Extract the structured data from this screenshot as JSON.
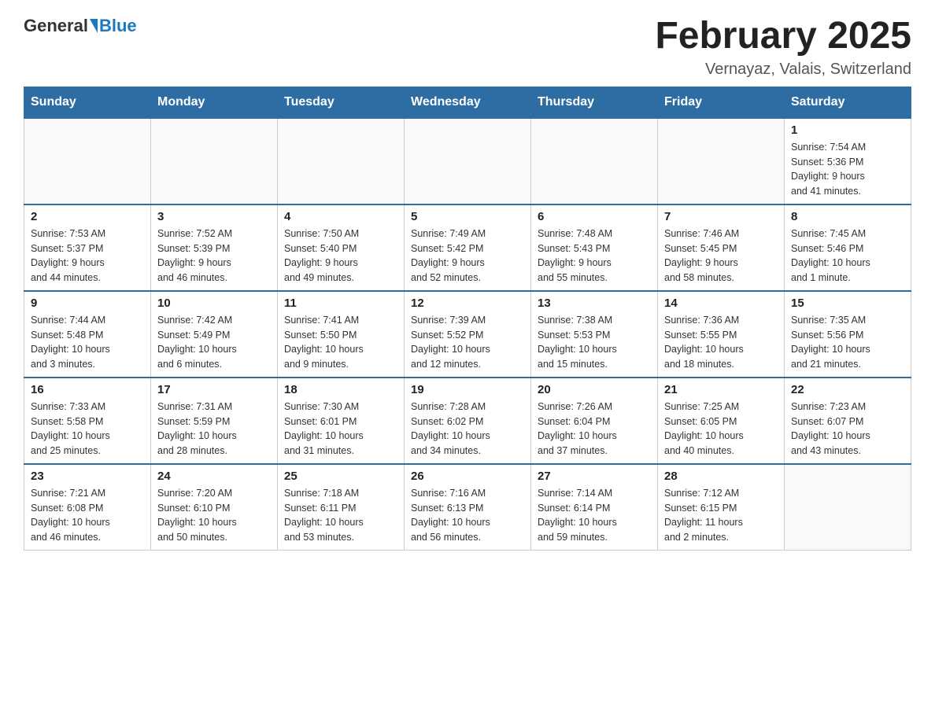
{
  "header": {
    "logo_general": "General",
    "logo_blue": "Blue",
    "title": "February 2025",
    "subtitle": "Vernayaz, Valais, Switzerland"
  },
  "days_of_week": [
    "Sunday",
    "Monday",
    "Tuesday",
    "Wednesday",
    "Thursday",
    "Friday",
    "Saturday"
  ],
  "weeks": [
    [
      {
        "day": "",
        "info": ""
      },
      {
        "day": "",
        "info": ""
      },
      {
        "day": "",
        "info": ""
      },
      {
        "day": "",
        "info": ""
      },
      {
        "day": "",
        "info": ""
      },
      {
        "day": "",
        "info": ""
      },
      {
        "day": "1",
        "info": "Sunrise: 7:54 AM\nSunset: 5:36 PM\nDaylight: 9 hours\nand 41 minutes."
      }
    ],
    [
      {
        "day": "2",
        "info": "Sunrise: 7:53 AM\nSunset: 5:37 PM\nDaylight: 9 hours\nand 44 minutes."
      },
      {
        "day": "3",
        "info": "Sunrise: 7:52 AM\nSunset: 5:39 PM\nDaylight: 9 hours\nand 46 minutes."
      },
      {
        "day": "4",
        "info": "Sunrise: 7:50 AM\nSunset: 5:40 PM\nDaylight: 9 hours\nand 49 minutes."
      },
      {
        "day": "5",
        "info": "Sunrise: 7:49 AM\nSunset: 5:42 PM\nDaylight: 9 hours\nand 52 minutes."
      },
      {
        "day": "6",
        "info": "Sunrise: 7:48 AM\nSunset: 5:43 PM\nDaylight: 9 hours\nand 55 minutes."
      },
      {
        "day": "7",
        "info": "Sunrise: 7:46 AM\nSunset: 5:45 PM\nDaylight: 9 hours\nand 58 minutes."
      },
      {
        "day": "8",
        "info": "Sunrise: 7:45 AM\nSunset: 5:46 PM\nDaylight: 10 hours\nand 1 minute."
      }
    ],
    [
      {
        "day": "9",
        "info": "Sunrise: 7:44 AM\nSunset: 5:48 PM\nDaylight: 10 hours\nand 3 minutes."
      },
      {
        "day": "10",
        "info": "Sunrise: 7:42 AM\nSunset: 5:49 PM\nDaylight: 10 hours\nand 6 minutes."
      },
      {
        "day": "11",
        "info": "Sunrise: 7:41 AM\nSunset: 5:50 PM\nDaylight: 10 hours\nand 9 minutes."
      },
      {
        "day": "12",
        "info": "Sunrise: 7:39 AM\nSunset: 5:52 PM\nDaylight: 10 hours\nand 12 minutes."
      },
      {
        "day": "13",
        "info": "Sunrise: 7:38 AM\nSunset: 5:53 PM\nDaylight: 10 hours\nand 15 minutes."
      },
      {
        "day": "14",
        "info": "Sunrise: 7:36 AM\nSunset: 5:55 PM\nDaylight: 10 hours\nand 18 minutes."
      },
      {
        "day": "15",
        "info": "Sunrise: 7:35 AM\nSunset: 5:56 PM\nDaylight: 10 hours\nand 21 minutes."
      }
    ],
    [
      {
        "day": "16",
        "info": "Sunrise: 7:33 AM\nSunset: 5:58 PM\nDaylight: 10 hours\nand 25 minutes."
      },
      {
        "day": "17",
        "info": "Sunrise: 7:31 AM\nSunset: 5:59 PM\nDaylight: 10 hours\nand 28 minutes."
      },
      {
        "day": "18",
        "info": "Sunrise: 7:30 AM\nSunset: 6:01 PM\nDaylight: 10 hours\nand 31 minutes."
      },
      {
        "day": "19",
        "info": "Sunrise: 7:28 AM\nSunset: 6:02 PM\nDaylight: 10 hours\nand 34 minutes."
      },
      {
        "day": "20",
        "info": "Sunrise: 7:26 AM\nSunset: 6:04 PM\nDaylight: 10 hours\nand 37 minutes."
      },
      {
        "day": "21",
        "info": "Sunrise: 7:25 AM\nSunset: 6:05 PM\nDaylight: 10 hours\nand 40 minutes."
      },
      {
        "day": "22",
        "info": "Sunrise: 7:23 AM\nSunset: 6:07 PM\nDaylight: 10 hours\nand 43 minutes."
      }
    ],
    [
      {
        "day": "23",
        "info": "Sunrise: 7:21 AM\nSunset: 6:08 PM\nDaylight: 10 hours\nand 46 minutes."
      },
      {
        "day": "24",
        "info": "Sunrise: 7:20 AM\nSunset: 6:10 PM\nDaylight: 10 hours\nand 50 minutes."
      },
      {
        "day": "25",
        "info": "Sunrise: 7:18 AM\nSunset: 6:11 PM\nDaylight: 10 hours\nand 53 minutes."
      },
      {
        "day": "26",
        "info": "Sunrise: 7:16 AM\nSunset: 6:13 PM\nDaylight: 10 hours\nand 56 minutes."
      },
      {
        "day": "27",
        "info": "Sunrise: 7:14 AM\nSunset: 6:14 PM\nDaylight: 10 hours\nand 59 minutes."
      },
      {
        "day": "28",
        "info": "Sunrise: 7:12 AM\nSunset: 6:15 PM\nDaylight: 11 hours\nand 2 minutes."
      },
      {
        "day": "",
        "info": ""
      }
    ]
  ]
}
